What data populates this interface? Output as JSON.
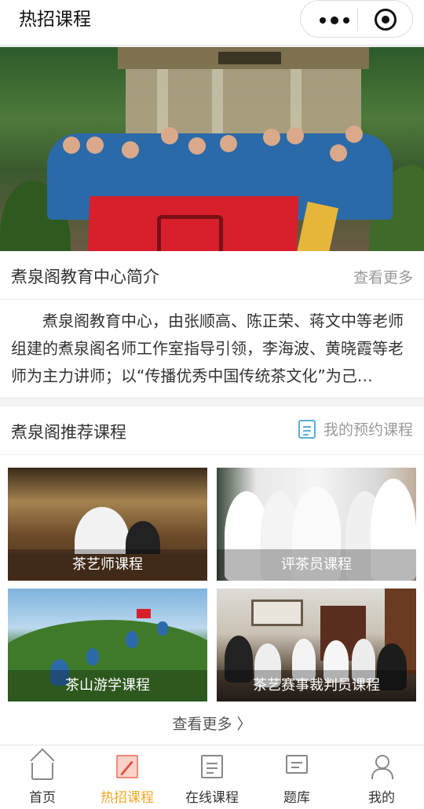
{
  "header": {
    "title": "热招课程"
  },
  "banner": {
    "slide_count": 4,
    "active_index": 1
  },
  "intro": {
    "title": "煮泉阁教育中心简介",
    "more": "查看更多",
    "text": "煮泉阁教育中心，由张顺高、陈正荣、蒋文中等老师组建的煮泉阁名师工作室指导引领，李海波、黄晓霞等老师为主力讲师；以“传播优秀中国传统茶文化”为己…"
  },
  "courses": {
    "title": "煮泉阁推荐课程",
    "booked_label": "我的预约课程",
    "items": [
      {
        "label": "茶艺师课程"
      },
      {
        "label": "评茶员课程"
      },
      {
        "label": "茶山游学课程"
      },
      {
        "label": "茶艺赛事裁判员课程"
      }
    ],
    "more": "查看更多 〉"
  },
  "tabbar": {
    "items": [
      {
        "label": "首页"
      },
      {
        "label": "热招课程"
      },
      {
        "label": "在线课程"
      },
      {
        "label": "题库"
      },
      {
        "label": "我的"
      }
    ],
    "active_index": 1,
    "active_color": "#f4a623"
  },
  "colors": {
    "accent": "#f4a623",
    "link_icon": "#5aaed8"
  }
}
